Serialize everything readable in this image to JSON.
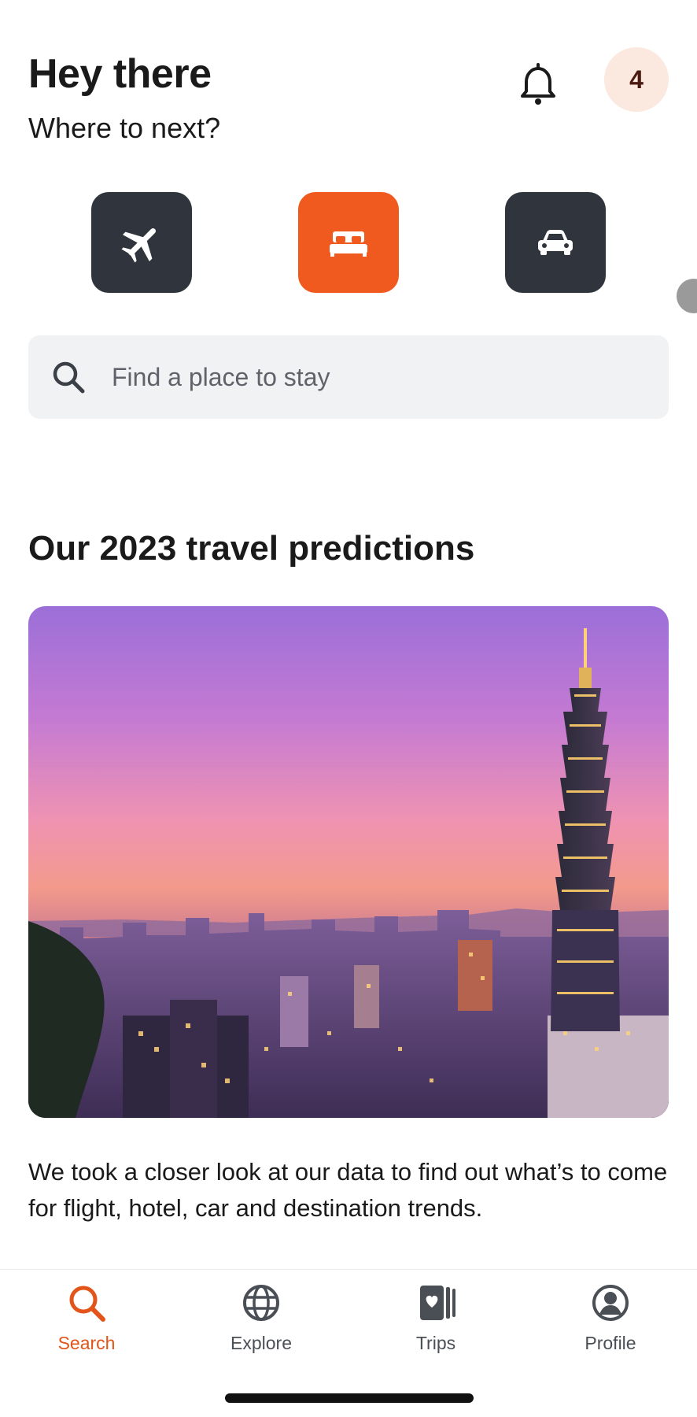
{
  "header": {
    "greeting": "Hey there",
    "subtitle": "Where to next?",
    "notification_icon": "bell-icon",
    "avatar_badge": "4"
  },
  "categories": [
    {
      "name": "Flights",
      "icon": "airplane-icon",
      "active": false
    },
    {
      "name": "Stays",
      "icon": "bed-icon",
      "active": true
    },
    {
      "name": "Cars",
      "icon": "car-icon",
      "active": false
    }
  ],
  "search": {
    "placeholder": "Find a place to stay",
    "icon": "search-icon"
  },
  "predictions": {
    "title": "Our 2023 travel predictions",
    "description": "We took a closer look at our data to find out what’s to come for flight, hotel, car and destination trends."
  },
  "nav": {
    "items": [
      {
        "label": "Search",
        "icon": "search-icon",
        "active": true
      },
      {
        "label": "Explore",
        "icon": "globe-icon",
        "active": false
      },
      {
        "label": "Trips",
        "icon": "trips-icon",
        "active": false
      },
      {
        "label": "Profile",
        "icon": "profile-icon",
        "active": false
      }
    ]
  },
  "colors": {
    "accent": "#f05a1e",
    "accent_text": "#e2541a",
    "dark_button": "#30353d",
    "avatar_bg": "#fbe8df",
    "search_bg": "#f1f2f4"
  }
}
